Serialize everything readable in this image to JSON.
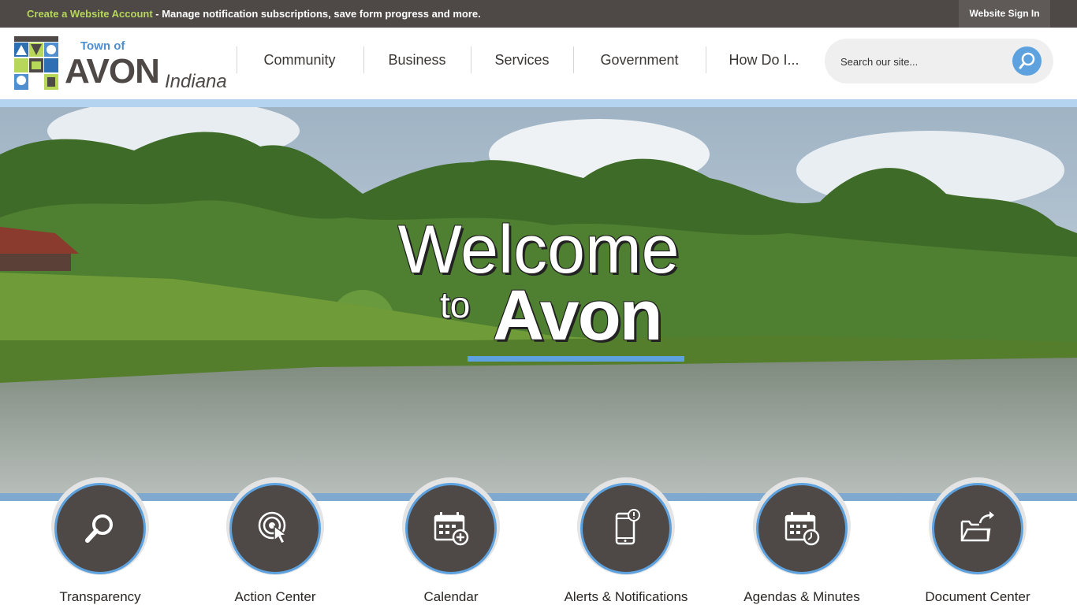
{
  "topbar": {
    "account_link": "Create a Website Account",
    "message": " - Manage notification subscriptions, save form progress and more.",
    "signin_label": "Website Sign In"
  },
  "logo": {
    "seal_text": "TOWN OF AVON",
    "town_of": "Town of",
    "name": "AVON",
    "state": "Indiana"
  },
  "nav": {
    "items": [
      {
        "label": "Community"
      },
      {
        "label": "Business"
      },
      {
        "label": "Services"
      },
      {
        "label": "Government"
      },
      {
        "label": "How Do I..."
      }
    ]
  },
  "search": {
    "placeholder": "Search our site...",
    "icon": "search-icon"
  },
  "hero": {
    "line1": "Welcome",
    "to": "to",
    "name": "Avon"
  },
  "quick_links": [
    {
      "label": "Transparency",
      "icon": "magnifier-icon"
    },
    {
      "label": "Action Center",
      "icon": "touch-icon"
    },
    {
      "label": "Calendar",
      "icon": "calendar-add-icon"
    },
    {
      "label": "Alerts & Notifications",
      "icon": "phone-alert-icon"
    },
    {
      "label": "Agendas & Minutes",
      "icon": "calendar-clock-icon"
    },
    {
      "label": "Document Center",
      "icon": "folder-share-icon"
    }
  ],
  "colors": {
    "topbar": "#4e4946",
    "accent_green": "#b6d75a",
    "accent_blue": "#5da2df",
    "brand_dark": "#4e4946"
  }
}
